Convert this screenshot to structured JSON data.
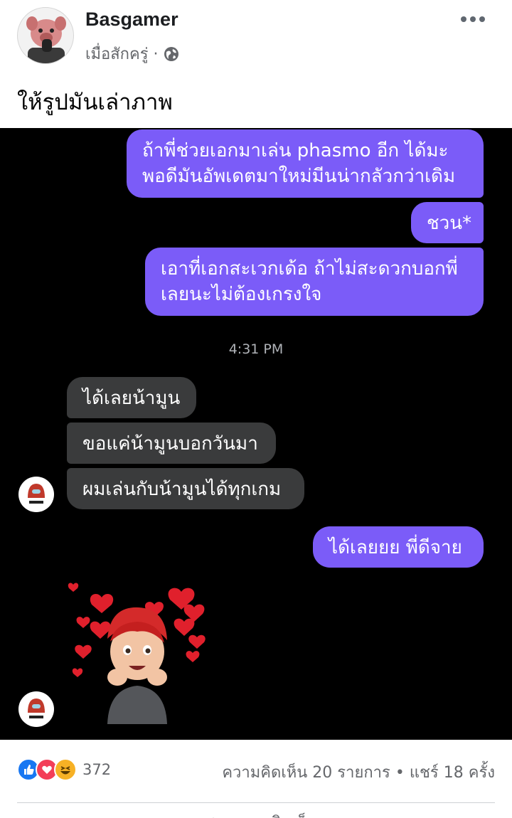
{
  "post": {
    "author": "Basgamer",
    "time": "เมื่อสักครู่ ·",
    "privacy_icon": "globe-icon",
    "caption": "ให้รูปมันเล่าภาพ"
  },
  "chat": {
    "messages": [
      {
        "side": "out",
        "text": "ถ้าพี่ช่วยเอกมาเล่น phasmo อีก ได้มะ\nพอดีมันอัพเดตมาใหม่มีนน่ากลัวกว่าเดิม"
      },
      {
        "side": "out",
        "text": "ชวน*"
      },
      {
        "side": "out",
        "text": "เอาที่เอกสะเวกเด้อ ถ้าไม่สะดวกบอกพี่\nเลยนะไม่ต้องเกรงใจ"
      },
      {
        "side": "in",
        "text": "ได้เลยน้ามูน"
      },
      {
        "side": "in",
        "text": "ขอแค่น้ามูนบอกวันมา"
      },
      {
        "side": "in",
        "text": "ผมเล่นกับน้ามูนได้ทุกเกม"
      },
      {
        "side": "out",
        "text": "ได้เลยยย พี่ดีจาย"
      }
    ],
    "timestamp": "4:31 PM",
    "sticker": "hearts-memoji-sticker",
    "avatar_icon": "impostor-avatar-icon"
  },
  "footer": {
    "reaction_count": "372",
    "stats": "ความคิดเห็น 20 รายการ • แชร์ 18 ครั้ง",
    "cut_label": "แสดงความคิดเห็น"
  },
  "colors": {
    "outgoing_bubble": "#7b5cf8",
    "incoming_bubble": "#3a3b3c",
    "like_blue": "#1877f2",
    "love_red": "#f33e58",
    "haha_yellow": "#f7b125"
  }
}
